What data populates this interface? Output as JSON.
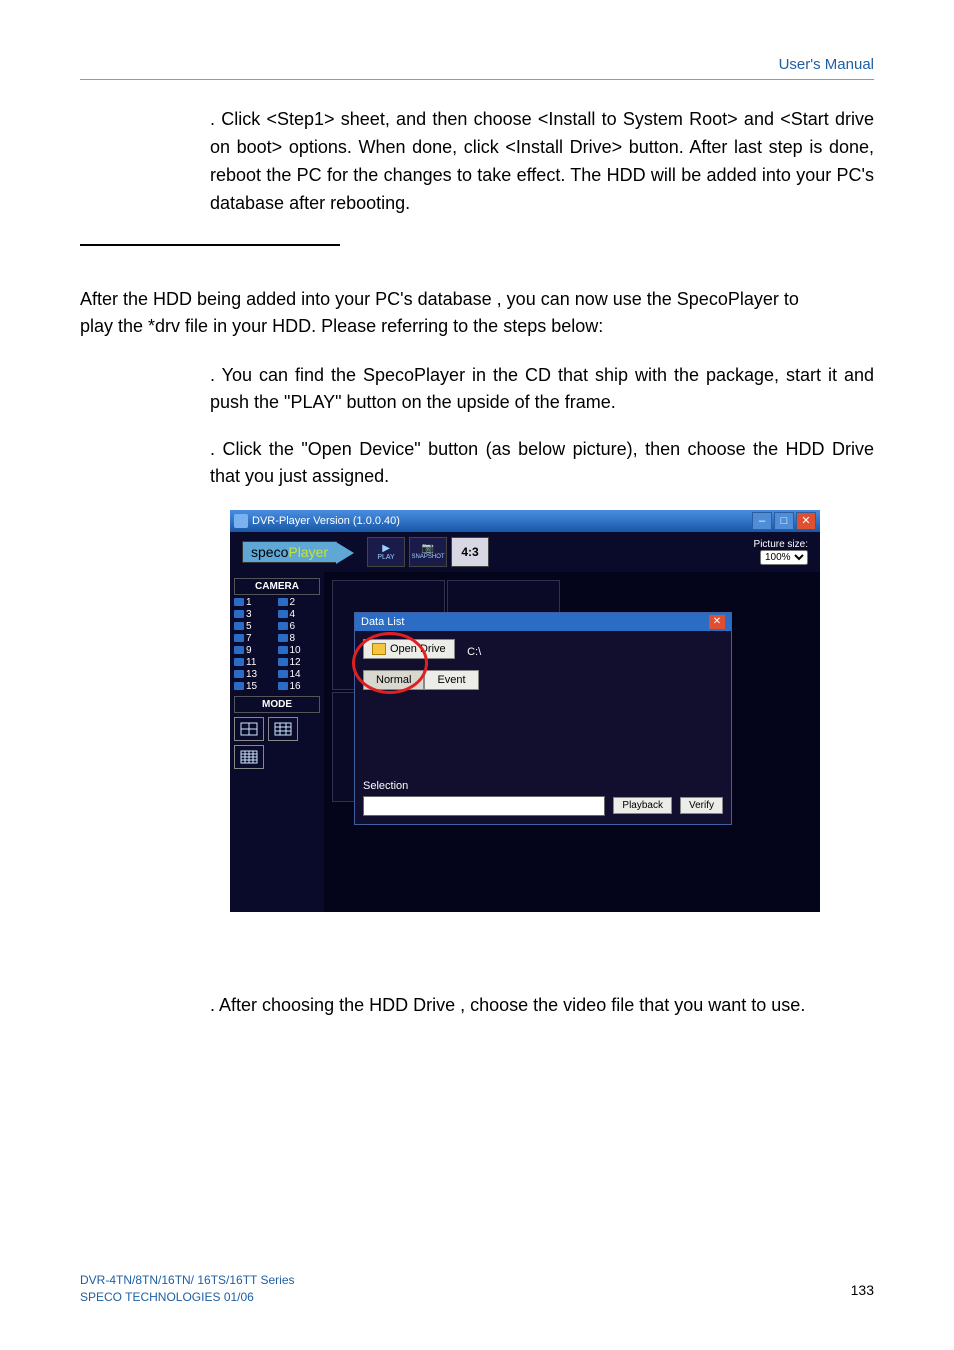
{
  "header": {
    "title": "User's Manual"
  },
  "body": {
    "para1": ". Click <Step1> sheet, and then choose <Install to System Root> and <Start drive on boot> options. When done, click <Install Drive> button. After last step is done, reboot the PC for the changes to take effect. The HDD will be added into your PC's database after rebooting.",
    "para2a": "After the HDD being added into your PC's database , you can now use the SpecoPlayer to",
    "para2b": "play the *drv file in your HDD. Please referring to the steps below:",
    "step1": ". You can find the SpecoPlayer in the CD that ship with the package, start it and push the \"PLAY\" button on the upside of the frame.",
    "step2": ". Click the \"Open Device\" button (as below picture), then choose the HDD Drive that you just assigned.",
    "step3": ". After choosing the HDD Drive , choose the video file that you want to use."
  },
  "app": {
    "title": "DVR-Player Version (1.0.0.40)",
    "brand_a": "speco",
    "brand_b": "Player",
    "play": "PLAY",
    "snapshot": "SNAPSHOT",
    "ratio": "4:3",
    "psize_label": "Picture size:",
    "psize_value": "100%",
    "camera": "CAMERA",
    "cams": [
      "1",
      "2",
      "3",
      "4",
      "5",
      "6",
      "7",
      "8",
      "9",
      "10",
      "11",
      "12",
      "13",
      "14",
      "15",
      "16"
    ],
    "mode": "MODE",
    "dlg_title": "Data List",
    "open_drive": "Open Drive",
    "drive": "C:\\",
    "tabs": [
      "Normal",
      "Event"
    ],
    "selection": "Selection",
    "playback": "Playback",
    "verify": "Verify"
  },
  "footer": {
    "line1": "DVR-4TN/8TN/16TN/ 16TS/16TT Series",
    "line2": "SPECO TECHNOLOGIES 01/06",
    "page": "133"
  }
}
